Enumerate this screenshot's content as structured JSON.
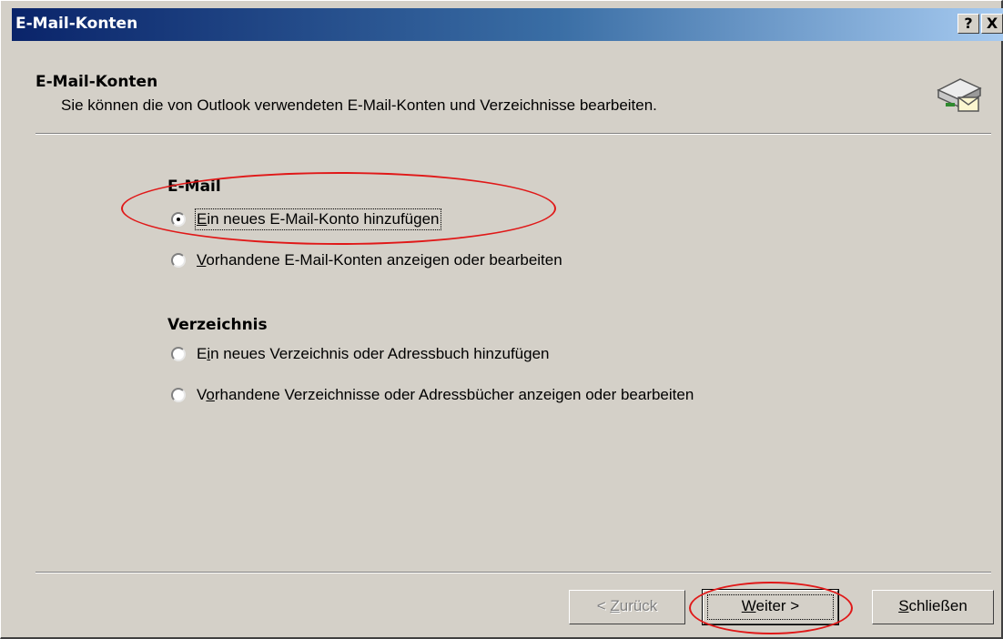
{
  "window": {
    "title": "E-Mail-Konten",
    "help_button": "?",
    "close_button": "X"
  },
  "header": {
    "title": "E-Mail-Konten",
    "subtitle": "Sie können die von Outlook verwendeten E-Mail-Konten und Verzeichnisse bearbeiten.",
    "icon": "email-accounts-icon"
  },
  "email_group": {
    "label": "E-Mail",
    "options": [
      {
        "access_key": "E",
        "rest": "in neues E-Mail-Konto hinzufügen",
        "checked": true,
        "focused": true
      },
      {
        "access_key": "V",
        "rest": "orhandene E-Mail-Konten anzeigen oder bearbeiten",
        "checked": false
      }
    ]
  },
  "directory_group": {
    "label": "Verzeichnis",
    "options": [
      {
        "before": "E",
        "access_key": "i",
        "rest": "n neues Verzeichnis oder Adressbuch hinzufügen",
        "checked": false
      },
      {
        "before": "V",
        "access_key": "o",
        "rest": "rhandene Verzeichnisse oder Adressbücher anzeigen oder bearbeiten",
        "checked": false
      }
    ]
  },
  "buttons": {
    "back": {
      "before": "< ",
      "access_key": "Z",
      "rest": "urück",
      "enabled": false
    },
    "next": {
      "access_key": "W",
      "rest": "eiter >",
      "enabled": true,
      "default": true
    },
    "close": {
      "access_key": "S",
      "rest": "chließen",
      "enabled": true
    }
  },
  "annotations": {
    "highlight_color": "#e01818"
  }
}
